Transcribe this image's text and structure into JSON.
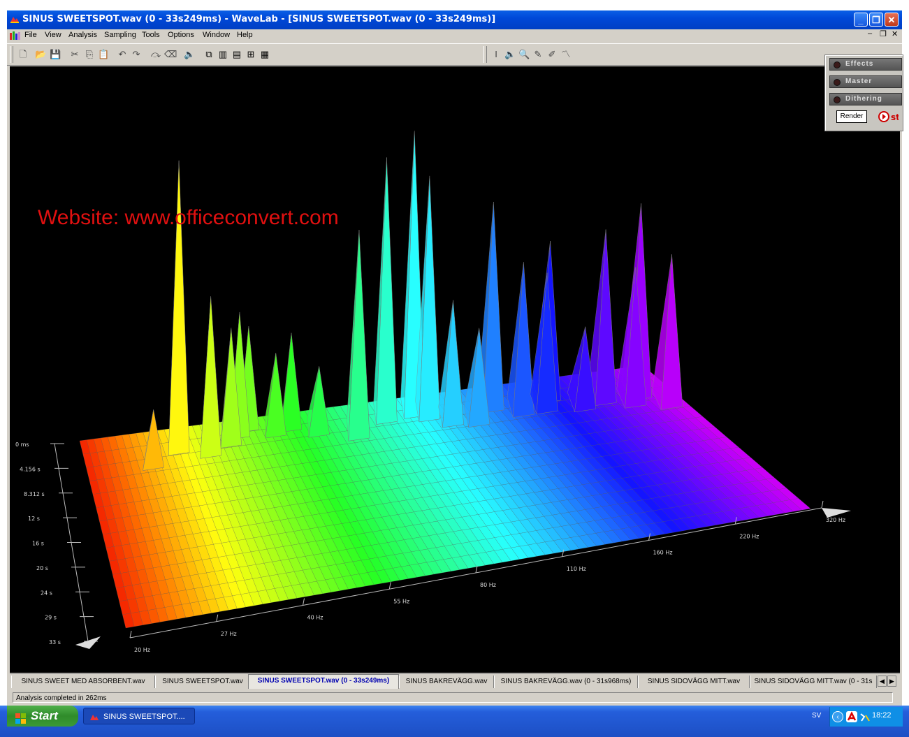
{
  "window": {
    "title": "SINUS SWEETSPOT.wav (0 - 33s249ms) - WaveLab - [SINUS SWEETSPOT.wav (0 - 33s249ms)]"
  },
  "menu": [
    "File",
    "View",
    "Analysis",
    "Sampling",
    "Tools",
    "Options",
    "Window",
    "Help"
  ],
  "watermark": "Website: www.officeconvert.com",
  "side_panel": {
    "buttons": [
      "Effects",
      "Master",
      "Dithering"
    ],
    "render_label": "Render",
    "play_icon": "play-circle-icon"
  },
  "spectrum": {
    "time_labels": [
      "0 ms",
      "4.156 s",
      "8.312 s",
      "12 s",
      "16 s",
      "20 s",
      "24 s",
      "29 s",
      "33 s"
    ],
    "freq_labels": [
      "20 Hz",
      "27 Hz",
      "40 Hz",
      "55 Hz",
      "80 Hz",
      "110 Hz",
      "160 Hz",
      "220 Hz",
      "320 Hz"
    ]
  },
  "tabs": [
    "SINUS SWEET MED ABSORBENT.wav",
    "SINUS SWEETSPOT.wav",
    "SINUS SWEETSPOT.wav (0 - 33s249ms)",
    "SINUS BAKREVÄGG.wav",
    "SINUS BAKREVÄGG.wav (0 - 31s968ms)",
    "SINUS SIDOVÄGG MITT.wav",
    "SINUS SIDOVÄGG MITT.wav (0 - 31s"
  ],
  "active_tab": 2,
  "status": "Analysis completed in 262ms",
  "taskbar": {
    "start_label": "Start",
    "task_item": "SINUS SWEETSPOT....",
    "language": "SV",
    "clock": "18:22"
  }
}
